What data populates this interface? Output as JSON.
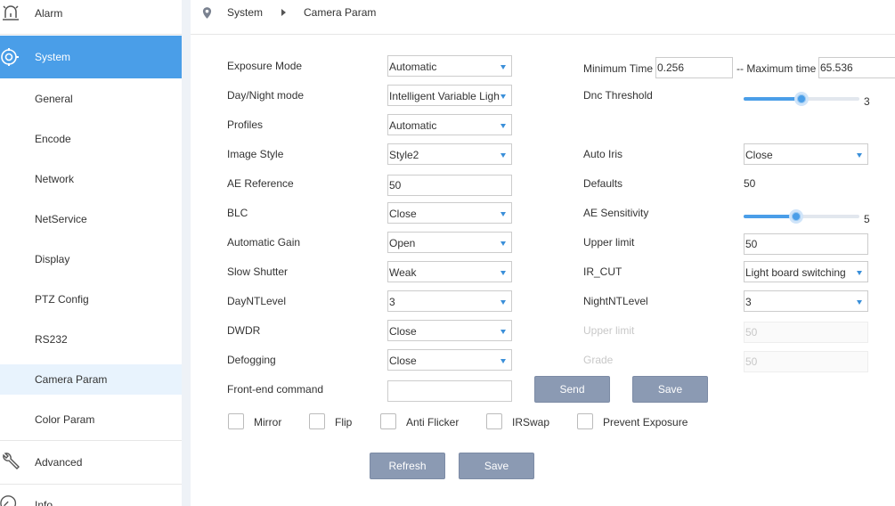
{
  "sidebar": {
    "alarm": "Alarm",
    "system": "System",
    "items": [
      "General",
      "Encode",
      "Network",
      "NetService",
      "Display",
      "PTZ Config",
      "RS232",
      "Camera Param",
      "Color Param"
    ],
    "advanced": "Advanced",
    "info": "Info"
  },
  "breadcrumb": {
    "root": "System",
    "current": "Camera Param"
  },
  "form": {
    "exposure_mode": {
      "label": "Exposure Mode",
      "value": "Automatic"
    },
    "day_night_mode": {
      "label": "Day/Night mode",
      "value": "Intelligent Variable Ligh"
    },
    "profiles": {
      "label": "Profiles",
      "value": "Automatic"
    },
    "image_style": {
      "label": "Image Style",
      "value": "Style2"
    },
    "ae_reference": {
      "label": "AE Reference",
      "value": "50"
    },
    "blc": {
      "label": "BLC",
      "value": "Close"
    },
    "automatic_gain": {
      "label": "Automatic Gain",
      "value": "Open"
    },
    "slow_shutter": {
      "label": "Slow Shutter",
      "value": "Weak"
    },
    "day_nt_level": {
      "label": "DayNTLevel",
      "value": "3"
    },
    "dwdr": {
      "label": "DWDR",
      "value": "Close"
    },
    "defogging": {
      "label": "Defogging",
      "value": "Close"
    },
    "front_end_command": {
      "label": "Front-end command",
      "value": ""
    },
    "min_time": {
      "label": "Minimum Time",
      "value": "0.256"
    },
    "max_time": {
      "label": "-- Maximum time",
      "value": "65.536"
    },
    "dnc_threshold": {
      "label": "Dnc Threshold",
      "value": "3",
      "fraction": 0.5
    },
    "auto_iris": {
      "label": "Auto Iris",
      "value": "Close"
    },
    "defaults": {
      "label": "Defaults",
      "value": "50"
    },
    "ae_sensitivity": {
      "label": "AE Sensitivity",
      "value": "5",
      "fraction": 0.45
    },
    "upper_limit": {
      "label": "Upper limit",
      "value": "50"
    },
    "ir_cut": {
      "label": "IR_CUT",
      "value": "Light board switching"
    },
    "night_nt_level": {
      "label": "NightNTLevel",
      "value": "3"
    },
    "upper_limit_disabled": {
      "label": "Upper limit",
      "value": "50"
    },
    "grade": {
      "label": "Grade",
      "value": "50"
    }
  },
  "buttons": {
    "send": "Send",
    "save_cmd": "Save",
    "refresh": "Refresh",
    "save": "Save"
  },
  "checkboxes": [
    "Mirror",
    "Flip",
    "Anti Flicker",
    "IRSwap",
    "Prevent Exposure"
  ],
  "colors": {
    "accent": "#4a9ee8",
    "button": "#8b9ab3"
  }
}
